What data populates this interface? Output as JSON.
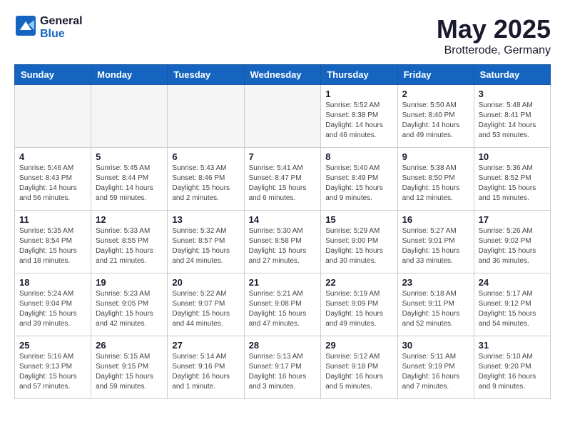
{
  "header": {
    "logo_general": "General",
    "logo_blue": "Blue",
    "month_title": "May 2025",
    "location": "Brotterode, Germany"
  },
  "weekdays": [
    "Sunday",
    "Monday",
    "Tuesday",
    "Wednesday",
    "Thursday",
    "Friday",
    "Saturday"
  ],
  "weeks": [
    [
      {
        "day": "",
        "info": ""
      },
      {
        "day": "",
        "info": ""
      },
      {
        "day": "",
        "info": ""
      },
      {
        "day": "",
        "info": ""
      },
      {
        "day": "1",
        "info": "Sunrise: 5:52 AM\nSunset: 8:38 PM\nDaylight: 14 hours\nand 46 minutes."
      },
      {
        "day": "2",
        "info": "Sunrise: 5:50 AM\nSunset: 8:40 PM\nDaylight: 14 hours\nand 49 minutes."
      },
      {
        "day": "3",
        "info": "Sunrise: 5:48 AM\nSunset: 8:41 PM\nDaylight: 14 hours\nand 53 minutes."
      }
    ],
    [
      {
        "day": "4",
        "info": "Sunrise: 5:46 AM\nSunset: 8:43 PM\nDaylight: 14 hours\nand 56 minutes."
      },
      {
        "day": "5",
        "info": "Sunrise: 5:45 AM\nSunset: 8:44 PM\nDaylight: 14 hours\nand 59 minutes."
      },
      {
        "day": "6",
        "info": "Sunrise: 5:43 AM\nSunset: 8:46 PM\nDaylight: 15 hours\nand 2 minutes."
      },
      {
        "day": "7",
        "info": "Sunrise: 5:41 AM\nSunset: 8:47 PM\nDaylight: 15 hours\nand 6 minutes."
      },
      {
        "day": "8",
        "info": "Sunrise: 5:40 AM\nSunset: 8:49 PM\nDaylight: 15 hours\nand 9 minutes."
      },
      {
        "day": "9",
        "info": "Sunrise: 5:38 AM\nSunset: 8:50 PM\nDaylight: 15 hours\nand 12 minutes."
      },
      {
        "day": "10",
        "info": "Sunrise: 5:36 AM\nSunset: 8:52 PM\nDaylight: 15 hours\nand 15 minutes."
      }
    ],
    [
      {
        "day": "11",
        "info": "Sunrise: 5:35 AM\nSunset: 8:54 PM\nDaylight: 15 hours\nand 18 minutes."
      },
      {
        "day": "12",
        "info": "Sunrise: 5:33 AM\nSunset: 8:55 PM\nDaylight: 15 hours\nand 21 minutes."
      },
      {
        "day": "13",
        "info": "Sunrise: 5:32 AM\nSunset: 8:57 PM\nDaylight: 15 hours\nand 24 minutes."
      },
      {
        "day": "14",
        "info": "Sunrise: 5:30 AM\nSunset: 8:58 PM\nDaylight: 15 hours\nand 27 minutes."
      },
      {
        "day": "15",
        "info": "Sunrise: 5:29 AM\nSunset: 9:00 PM\nDaylight: 15 hours\nand 30 minutes."
      },
      {
        "day": "16",
        "info": "Sunrise: 5:27 AM\nSunset: 9:01 PM\nDaylight: 15 hours\nand 33 minutes."
      },
      {
        "day": "17",
        "info": "Sunrise: 5:26 AM\nSunset: 9:02 PM\nDaylight: 15 hours\nand 36 minutes."
      }
    ],
    [
      {
        "day": "18",
        "info": "Sunrise: 5:24 AM\nSunset: 9:04 PM\nDaylight: 15 hours\nand 39 minutes."
      },
      {
        "day": "19",
        "info": "Sunrise: 5:23 AM\nSunset: 9:05 PM\nDaylight: 15 hours\nand 42 minutes."
      },
      {
        "day": "20",
        "info": "Sunrise: 5:22 AM\nSunset: 9:07 PM\nDaylight: 15 hours\nand 44 minutes."
      },
      {
        "day": "21",
        "info": "Sunrise: 5:21 AM\nSunset: 9:08 PM\nDaylight: 15 hours\nand 47 minutes."
      },
      {
        "day": "22",
        "info": "Sunrise: 5:19 AM\nSunset: 9:09 PM\nDaylight: 15 hours\nand 49 minutes."
      },
      {
        "day": "23",
        "info": "Sunrise: 5:18 AM\nSunset: 9:11 PM\nDaylight: 15 hours\nand 52 minutes."
      },
      {
        "day": "24",
        "info": "Sunrise: 5:17 AM\nSunset: 9:12 PM\nDaylight: 15 hours\nand 54 minutes."
      }
    ],
    [
      {
        "day": "25",
        "info": "Sunrise: 5:16 AM\nSunset: 9:13 PM\nDaylight: 15 hours\nand 57 minutes."
      },
      {
        "day": "26",
        "info": "Sunrise: 5:15 AM\nSunset: 9:15 PM\nDaylight: 15 hours\nand 59 minutes."
      },
      {
        "day": "27",
        "info": "Sunrise: 5:14 AM\nSunset: 9:16 PM\nDaylight: 16 hours\nand 1 minute."
      },
      {
        "day": "28",
        "info": "Sunrise: 5:13 AM\nSunset: 9:17 PM\nDaylight: 16 hours\nand 3 minutes."
      },
      {
        "day": "29",
        "info": "Sunrise: 5:12 AM\nSunset: 9:18 PM\nDaylight: 16 hours\nand 5 minutes."
      },
      {
        "day": "30",
        "info": "Sunrise: 5:11 AM\nSunset: 9:19 PM\nDaylight: 16 hours\nand 7 minutes."
      },
      {
        "day": "31",
        "info": "Sunrise: 5:10 AM\nSunset: 9:20 PM\nDaylight: 16 hours\nand 9 minutes."
      }
    ]
  ]
}
